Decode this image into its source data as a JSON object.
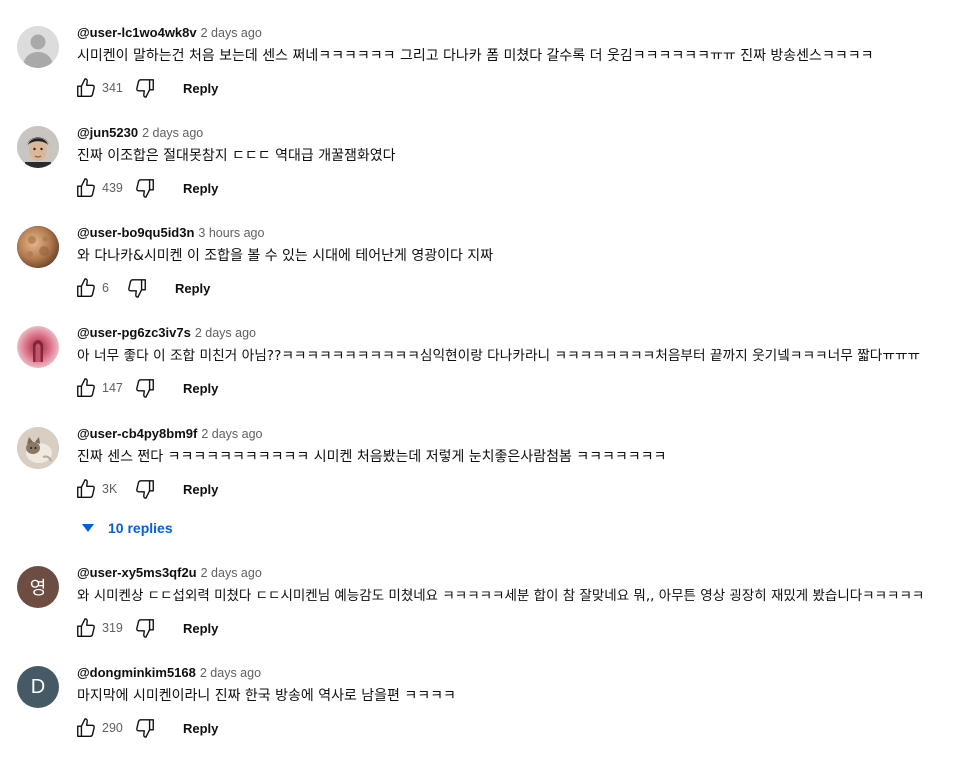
{
  "comments": [
    {
      "author": "@user-lc1wo4wk8v",
      "time": "2 days ago",
      "text": "시미켄이 말하는건 처음 보는데 센스 쩌네ㅋㅋㅋㅋㅋㅋ 그리고 다나카 폼 미쳤다 갈수록 더 웃김ㅋㅋㅋㅋㅋㅋㅠㅠ 진짜 방송센스ㅋㅋㅋㅋ",
      "likes": "341",
      "reply_label": "Reply",
      "avatar_type": "default-person"
    },
    {
      "author": "@jun5230",
      "time": "2 days ago",
      "text": "진짜 이조합은 절대못참지 ㄷㄷㄷ 역대급 개꿀잼화였다",
      "likes": "439",
      "reply_label": "Reply",
      "avatar_type": "photo-face"
    },
    {
      "author": "@user-bo9qu5id3n",
      "time": "3 hours ago",
      "text": "와 다나카&시미켄 이 조합을 볼 수 있는 시대에 테어난게 영광이다 지짜",
      "likes": "6",
      "reply_label": "Reply",
      "avatar_type": "photo-moon"
    },
    {
      "author": "@user-pg6zc3iv7s",
      "time": "2 days ago",
      "text": "아 너무 좋다 이 조합 미친거 아님??ㅋㅋㅋㅋㅋㅋㅋㅋㅋㅋㅋ심익현이랑 다나카라니 ㅋㅋㅋㅋㅋㅋㅋㅋ처음부터 끝까지 웃기넼ㅋㅋㅋ너무 짧다ㅠㅠㅠ",
      "likes": "147",
      "reply_label": "Reply",
      "avatar_type": "photo-pink"
    },
    {
      "author": "@user-cb4py8bm9f",
      "time": "2 days ago",
      "text": "진짜 센스 쩐다 ㅋㅋㅋㅋㅋㅋㅋㅋㅋㅋㅋ 시미켄 처음봤는데 저렇게 눈치좋은사람첨봄 ㅋㅋㅋㅋㅋㅋㅋ",
      "likes": "3K",
      "reply_label": "Reply",
      "avatar_type": "photo-cat",
      "replies_label": "10 replies"
    },
    {
      "author": "@user-xy5ms3qf2u",
      "time": "2 days ago",
      "text": "와 시미켄상 ㄷㄷ섭외력 미쳤다 ㄷㄷ시미켄님 예능감도 미쳤네요 ㅋㅋㅋㅋㅋ세분 합이 참 잘맞네요 뭐,, 아무튼 영상 굉장히 재밌게 봤습니다ㅋㅋㅋㅋㅋ",
      "likes": "319",
      "reply_label": "Reply",
      "avatar_letter": "영",
      "avatar_color": "#6d4c41"
    },
    {
      "author": "@dongminkim5168",
      "time": "2 days ago",
      "text": "마지막에 시미켄이라니 진짜 한국 방송에 역사로 남을편 ㅋㅋㅋㅋ",
      "likes": "290",
      "reply_label": "Reply",
      "avatar_letter": "D",
      "avatar_color": "#455a64"
    }
  ]
}
